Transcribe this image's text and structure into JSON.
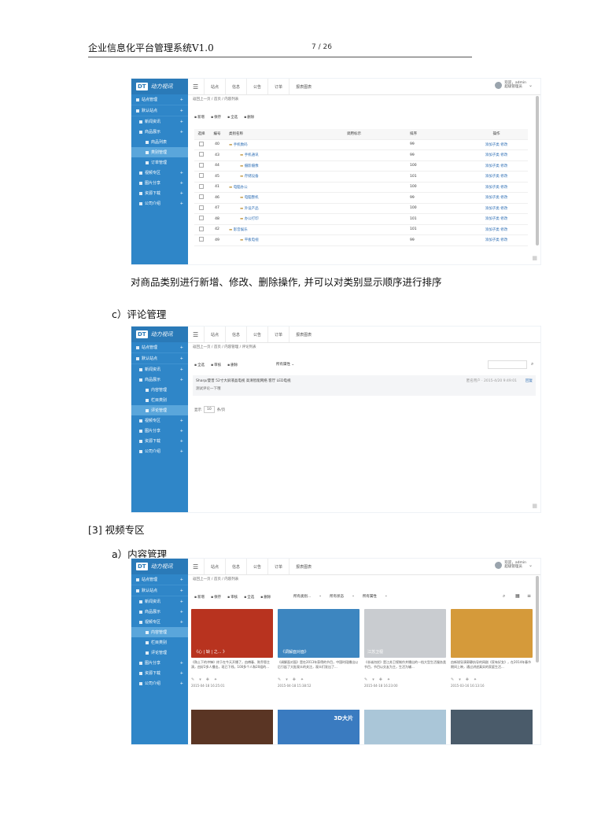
{
  "doc_header": {
    "title": "企业信息化平台管理系统V1.0",
    "page": "7 / 26"
  },
  "app": {
    "logo_mark": "DT",
    "logo_text": "动力视讯",
    "top_nav": [
      "站点",
      "信息",
      "公告",
      "订单",
      "报表图表"
    ],
    "user_line1": "欢迎，admin",
    "user_line2": "超级管理员"
  },
  "shot1": {
    "sidebar": [
      {
        "label": "站点管理",
        "level": 1
      },
      {
        "label": "默认站点",
        "level": 1
      },
      {
        "label": "新闻资讯",
        "level": 2
      },
      {
        "label": "商品展示",
        "level": 2
      },
      {
        "label": "商品列表",
        "level": 3
      },
      {
        "label": "类别管理",
        "level": 3,
        "active": true
      },
      {
        "label": "订单管理",
        "level": 3
      },
      {
        "label": "视频专区",
        "level": 2
      },
      {
        "label": "图片分享",
        "level": 2
      },
      {
        "label": "资源下载",
        "level": 2
      },
      {
        "label": "公司介绍",
        "level": 2
      }
    ],
    "breadcrumb": "返回上一页 / 首页 / 内容列表",
    "toolbar": [
      "新增",
      "保存",
      "全选",
      "删除"
    ],
    "table_headers": [
      "选择",
      "编号",
      "类别名称",
      "调用标示",
      "排序",
      "操作"
    ],
    "rows": [
      {
        "id": "40",
        "name": "手机数码",
        "sort": "99"
      },
      {
        "id": "43",
        "name": "手机通讯",
        "sort": "99"
      },
      {
        "id": "44",
        "name": "摄影摄像",
        "sort": "100"
      },
      {
        "id": "45",
        "name": "存储设备",
        "sort": "101"
      },
      {
        "id": "41",
        "name": "电脑办公",
        "sort": "100"
      },
      {
        "id": "46",
        "name": "电脑整机",
        "sort": "99"
      },
      {
        "id": "47",
        "name": "外设产品",
        "sort": "100"
      },
      {
        "id": "48",
        "name": "办公打印",
        "sort": "101"
      },
      {
        "id": "42",
        "name": "影音娱乐",
        "sort": "101"
      },
      {
        "id": "49",
        "name": "平板电视",
        "sort": "99"
      }
    ],
    "row_action": "添加子类 修改"
  },
  "caption1": "对商品类别进行新增、修改、删除操作, 并可以对类别显示顺序进行排序",
  "heading_c": "c）评论管理",
  "shot2": {
    "sidebar": [
      {
        "label": "站点管理",
        "level": 1
      },
      {
        "label": "默认站点",
        "level": 1
      },
      {
        "label": "新闻资讯",
        "level": 2
      },
      {
        "label": "商品展示",
        "level": 2
      },
      {
        "label": "内容管理",
        "level": 3
      },
      {
        "label": "栏目类别",
        "level": 3
      },
      {
        "label": "评论管理",
        "level": 3,
        "active": true
      },
      {
        "label": "视频专区",
        "level": 2
      },
      {
        "label": "图片分享",
        "level": 2
      },
      {
        "label": "资源下载",
        "level": 2
      },
      {
        "label": "公司介绍",
        "level": 2
      }
    ],
    "breadcrumb": "返回上一页 / 首页 / 内容管理 / 评论列表",
    "toolbar": [
      "全选",
      "审核",
      "删除"
    ],
    "filter": "所有属性",
    "comment_title": "Sharp/夏普 52寸大屏液晶电视 高清智能网络 客厅 LED电视",
    "comment_body": "测试评论一下哦",
    "comment_meta": "匿名用户 · 2015-4/20 9:49:01",
    "comment_action": "回复",
    "pager_left": "显示",
    "pager_num": "10",
    "pager_right": "条/页"
  },
  "section_heading": "[3] 视频专区",
  "heading_a": "a）内容管理",
  "shot3": {
    "sidebar": [
      {
        "label": "站点管理",
        "level": 1
      },
      {
        "label": "默认站点",
        "level": 1
      },
      {
        "label": "新闻资讯",
        "level": 2
      },
      {
        "label": "商品展示",
        "level": 2
      },
      {
        "label": "视频专区",
        "level": 2
      },
      {
        "label": "内容管理",
        "level": 3,
        "active": true
      },
      {
        "label": "栏目类别",
        "level": 3
      },
      {
        "label": "评论管理",
        "level": 3
      },
      {
        "label": "图片分享",
        "level": 2
      },
      {
        "label": "资源下载",
        "level": 2
      },
      {
        "label": "公司介绍",
        "level": 2
      }
    ],
    "breadcrumb": "返回上一页 / 首页 / 内容列表",
    "toolbar": [
      "新增",
      "保存",
      "审核",
      "全选",
      "删除"
    ],
    "filters": [
      "所有类别...",
      "所有状态",
      "所有属性"
    ],
    "cards": [
      {
        "overlay": "《心 | 缺 | 之... 》",
        "desc": "《熟土下的冲锋》终于在今天开播了，由傅春、陈乔恩主演，由好2多人播出，现已下线，100多个人和20组的...",
        "date": "2015-04-18 16:25:01",
        "color": "#b8331f"
      },
      {
        "overlay": "《调解面对面》",
        "desc": "《调解面对面》是在2013年获得的节目，中国时段播出以后引起了大批观众的关注，观众们发出了...",
        "date": "2015-04-18 15:38:52",
        "color": "#3d86c0"
      },
      {
        "overlay": "江苏卫视",
        "desc": "《非诚勿扰》是江苏卫视制作并播出的一档大型生活服务类节目，节目以交友为主，生活为辅...",
        "date": "2015-04-18 16:23:00",
        "color": "#c9ccd0"
      },
      {
        "overlay": "",
        "desc": "由新锐导演郭静执导的网剧《家有好女》，在2014年春节期间上映，通过讲述真实的家庭生活...",
        "date": "2015-03-16 16:13:16",
        "color": "#d59a3a"
      }
    ],
    "row2_colors": [
      "#5a3524",
      "#3a7bc0",
      "#aac6d8",
      "#4a5b6a"
    ],
    "row2_overlay": "3D大片"
  }
}
